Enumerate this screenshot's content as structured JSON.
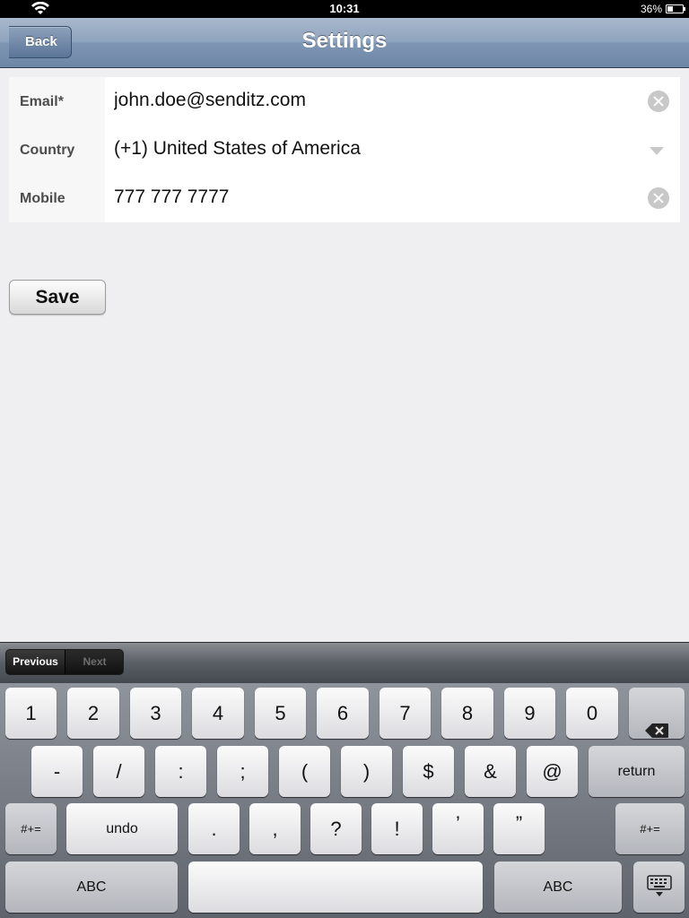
{
  "status": {
    "time": "10:31",
    "battery": "36%",
    "battery_level": 0.36
  },
  "nav": {
    "title": "Settings",
    "back_label": "Back"
  },
  "form": {
    "email": {
      "label": "Email*",
      "value": "john.doe@senditz.com"
    },
    "country": {
      "label": "Country",
      "value": "(+1) United States of America"
    },
    "mobile": {
      "label": "Mobile",
      "value": "777 777 7777"
    }
  },
  "save_label": "Save",
  "kb_toolbar": {
    "previous": "Previous",
    "next": "Next"
  },
  "keyboard": {
    "row1": [
      "1",
      "2",
      "3",
      "4",
      "5",
      "6",
      "7",
      "8",
      "9",
      "0"
    ],
    "row2": [
      "-",
      "/",
      ":",
      ";",
      "(",
      ")",
      "$",
      "&",
      "@"
    ],
    "return": "return",
    "row3_left": "#+=",
    "undo": "undo",
    "row3": [
      ".",
      ",",
      "?",
      "!",
      "’",
      "”"
    ],
    "row3_right": "#+=",
    "abc_left": "ABC",
    "abc_right": "ABC"
  },
  "icons": {
    "wifi": "wifi-icon",
    "battery": "battery-icon",
    "clear": "clear-icon",
    "dropdown": "dropdown-icon",
    "backspace": "backspace-icon",
    "hide_keyboard": "hide-keyboard-icon"
  }
}
